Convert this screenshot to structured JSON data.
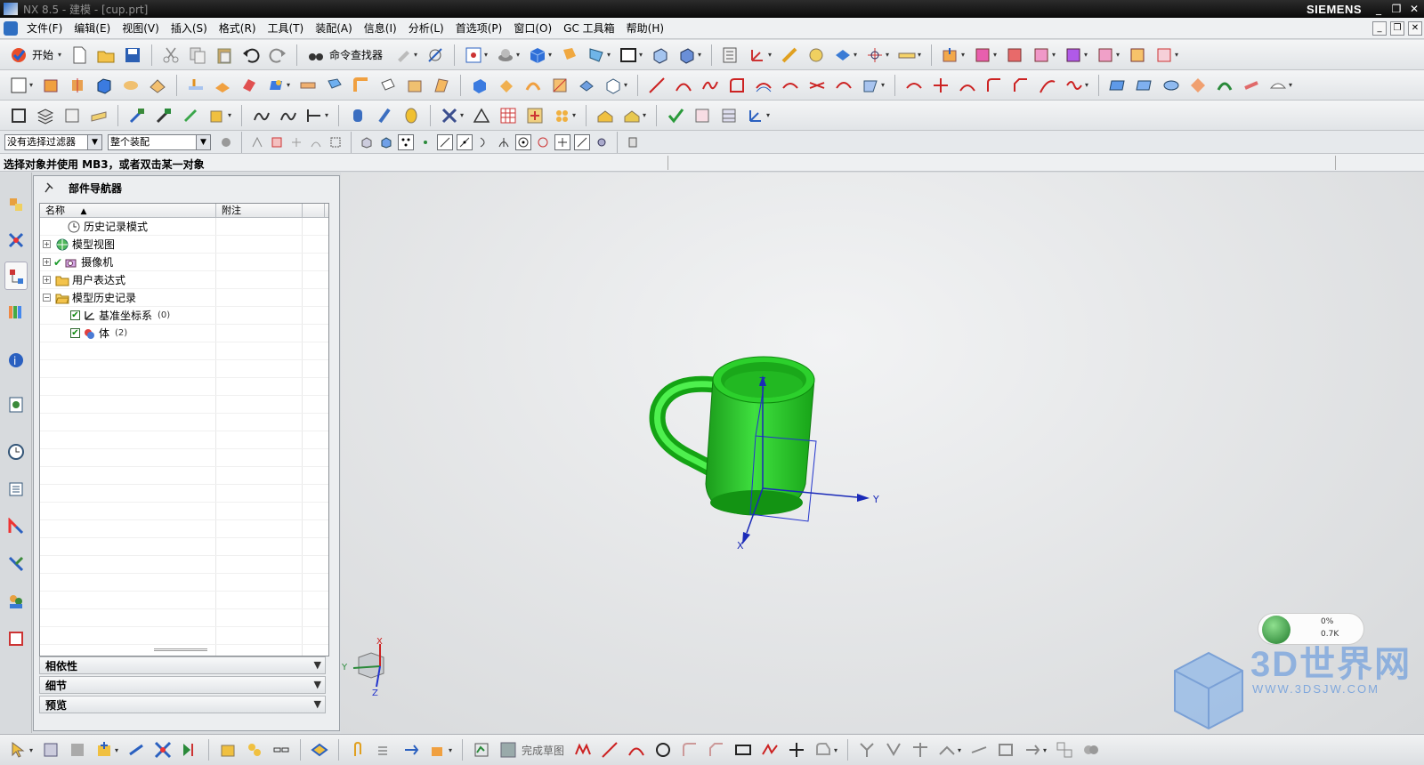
{
  "window": {
    "title": "NX 8.5 - 建模 - [cup.prt]",
    "brand": "SIEMENS",
    "controls": [
      "_",
      "❐",
      "✕"
    ]
  },
  "menu": {
    "items": [
      "文件(F)",
      "编辑(E)",
      "视图(V)",
      "插入(S)",
      "格式(R)",
      "工具(T)",
      "装配(A)",
      "信息(I)",
      "分析(L)",
      "首选项(P)",
      "窗口(O)",
      "GC 工具箱",
      "帮助(H)"
    ]
  },
  "toolbar": {
    "start_label": "开始",
    "command_finder_label": "命令查找器"
  },
  "selection": {
    "filter": "没有选择过滤器",
    "scope": "整个装配"
  },
  "status": {
    "message": "选择对象并使用 MB3，或者双击某一对象"
  },
  "navigator": {
    "title": "部件导航器",
    "columns": [
      "名称",
      "附注"
    ],
    "nodes": [
      {
        "label": "历史记录模式",
        "expander": "",
        "icon": "clock-icon",
        "level": 0
      },
      {
        "label": "模型视图",
        "expander": "+",
        "icon": "model-views-icon",
        "level": 0
      },
      {
        "label": "摄像机",
        "expander": "+",
        "icon": "camera-icon",
        "level": 0,
        "checked": true
      },
      {
        "label": "用户表达式",
        "expander": "+",
        "icon": "folder-icon",
        "level": 0
      },
      {
        "label": "模型历史记录",
        "expander": "−",
        "icon": "folder-open-icon",
        "level": 0
      },
      {
        "label": "基准坐标系",
        "count": "(0)",
        "icon": "datum-csys-icon",
        "level": 1,
        "checked": true
      },
      {
        "label": "体",
        "count": "(2)",
        "icon": "body-icon",
        "level": 1,
        "checked": true
      }
    ],
    "sections": [
      "相依性",
      "细节",
      "预览"
    ]
  },
  "graphics": {
    "model": "cup",
    "model_color": "#2ecc2e",
    "axes": {
      "x": "X",
      "y": "Y",
      "z": "Z"
    }
  },
  "bottom": {
    "finish_sketch_label": "完成草图"
  },
  "watermark": {
    "text": "3D世界网",
    "url": "WWW.3DSJW.COM",
    "speed_top": "0%",
    "speed_bottom": "0.7K"
  }
}
